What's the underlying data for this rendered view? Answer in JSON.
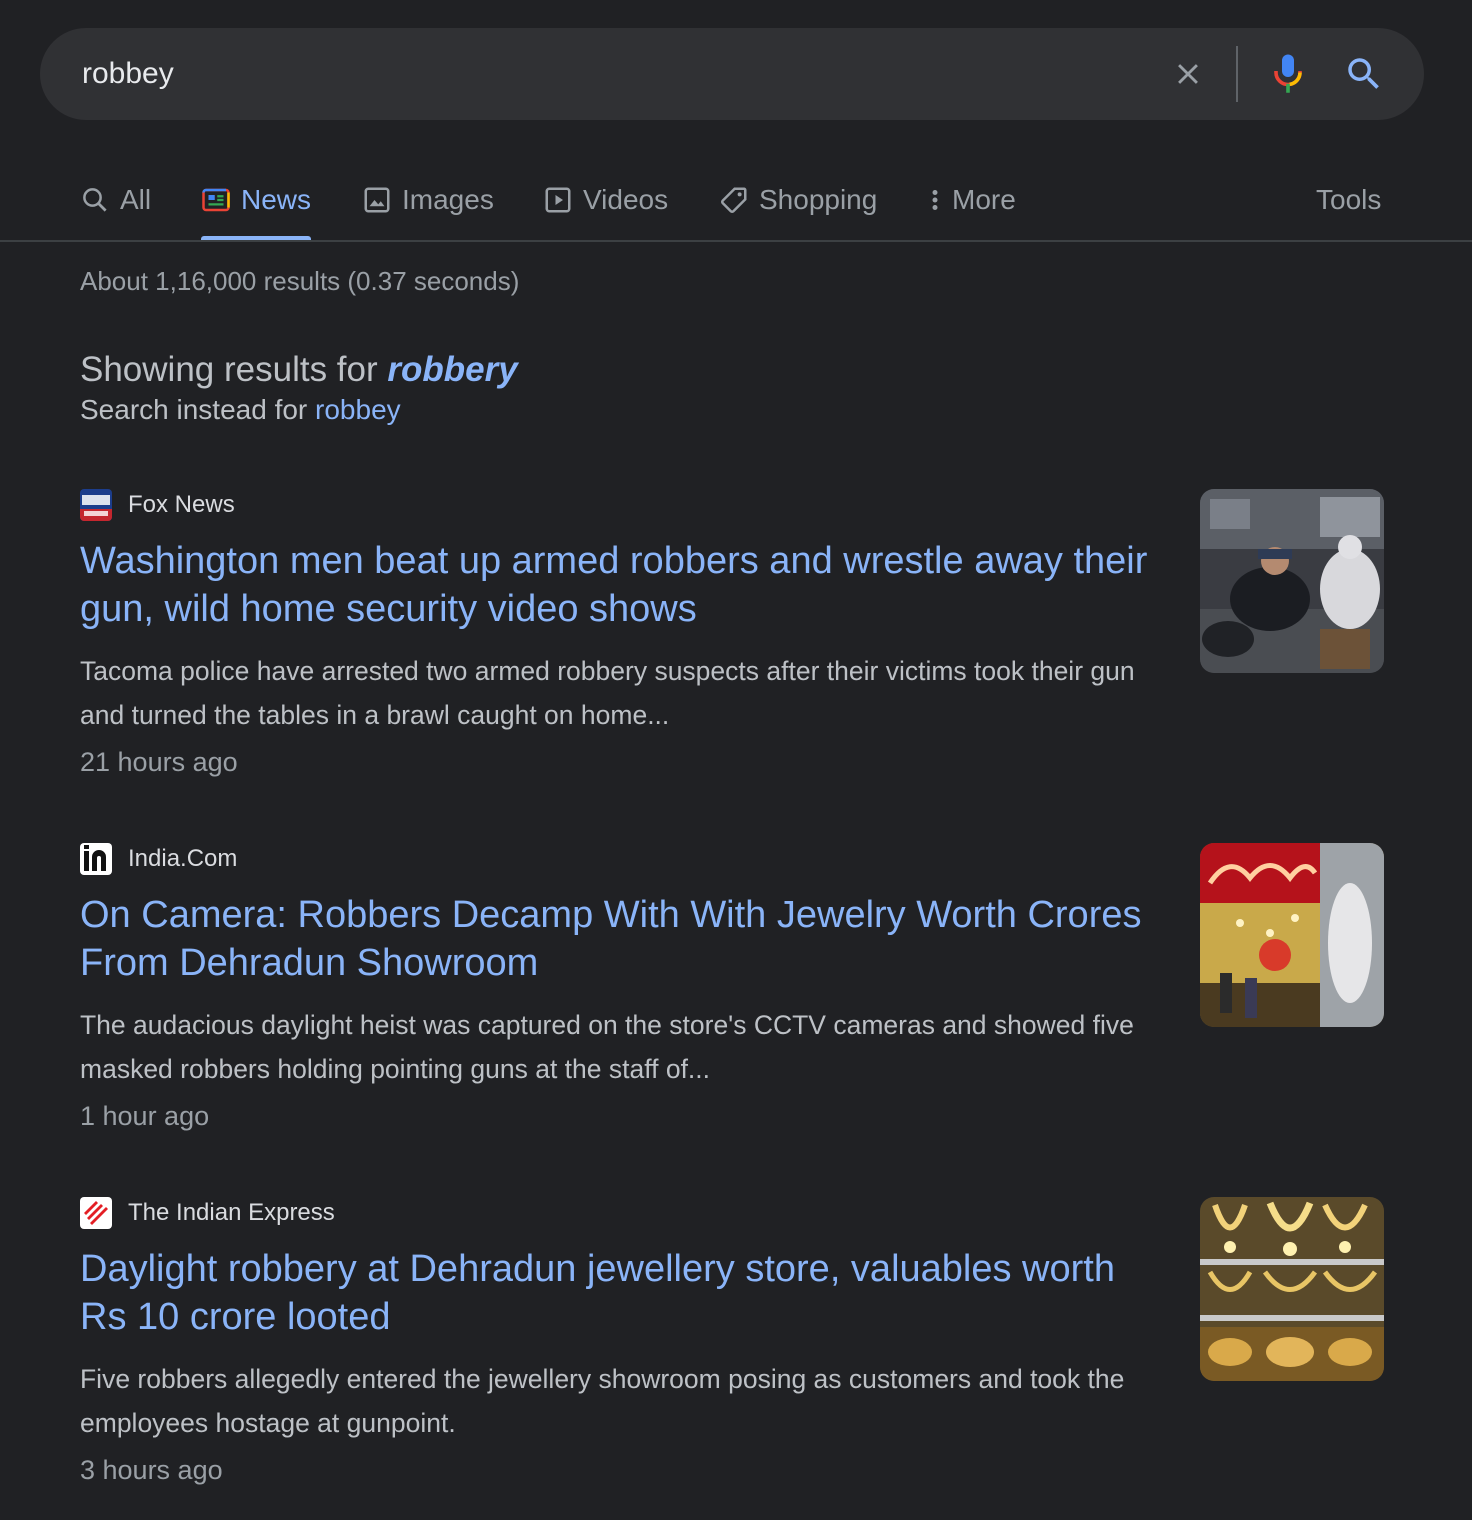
{
  "search": {
    "query": "robbey"
  },
  "tabs": [
    {
      "label": "All",
      "icon": "search-icon"
    },
    {
      "label": "News",
      "icon": "news-icon",
      "active": true
    },
    {
      "label": "Images",
      "icon": "image-icon"
    },
    {
      "label": "Videos",
      "icon": "video-play-icon"
    },
    {
      "label": "Shopping",
      "icon": "tag-icon"
    },
    {
      "label": "More",
      "icon": "more-vertical-icon"
    }
  ],
  "tools_label": "Tools",
  "result_stats": "About 1,16,000 results (0.37 seconds)",
  "spelling": {
    "showing_prefix": "Showing results for ",
    "corrected": "robbery",
    "instead_prefix": "Search instead for ",
    "original": "robbey"
  },
  "results": [
    {
      "source": "Fox News",
      "title": "Washington men beat up armed robbers and wrestle away their gun, wild home security video shows",
      "snippet": "Tacoma police have arrested two armed robbery suspects after their victims took their gun and turned the tables in a brawl caught on home...",
      "time": "21 hours ago"
    },
    {
      "source": "India.Com",
      "title": "On Camera: Robbers Decamp With With Jewelry Worth Crores From Dehradun Showroom",
      "snippet": "The audacious daylight heist was captured on the store's CCTV cameras and showed five masked robbers holding pointing guns at the staff of...",
      "time": "1 hour ago"
    },
    {
      "source": "The Indian Express",
      "title": "Daylight robbery at Dehradun jewellery store, valuables worth Rs 10 crore looted",
      "snippet": "Five robbers allegedly entered the jewellery showroom posing as customers and took the employees hostage at gunpoint.",
      "time": "3 hours ago"
    }
  ],
  "colors": {
    "background": "#202124",
    "link": "#8ab4f8",
    "text": "#bdc1c6",
    "muted": "#9aa0a6"
  }
}
